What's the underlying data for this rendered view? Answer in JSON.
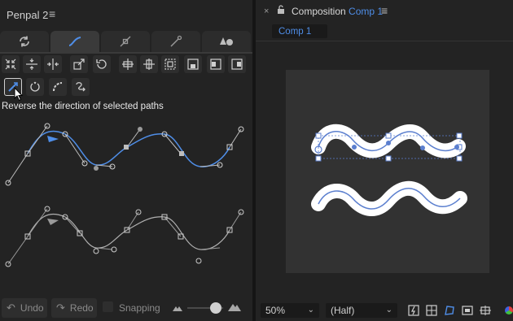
{
  "left_panel": {
    "title": "Penpal 2",
    "menu_icon": "hamburger-icon",
    "tabs": [
      {
        "icon": "refresh-icon"
      },
      {
        "icon": "curve-icon",
        "active": true
      },
      {
        "icon": "node-icon"
      },
      {
        "icon": "line-pen-icon"
      },
      {
        "icon": "shapes-icon"
      }
    ],
    "tooltip": "Reverse the direction of selected paths",
    "buttons": {
      "undo": "Undo",
      "redo": "Redo",
      "snapping": "Snapping"
    },
    "size_slider_value": 0.75
  },
  "right_panel": {
    "header_title": "Composition",
    "comp_name": "Comp 1",
    "tab_label": "Comp 1",
    "zoom": "50%",
    "resolution": "(Half)"
  },
  "colors": {
    "accent": "#4f8ee8",
    "path_blue": "#5b7fcf",
    "panel_bg": "#232323",
    "canvas_bg": "#323232"
  }
}
